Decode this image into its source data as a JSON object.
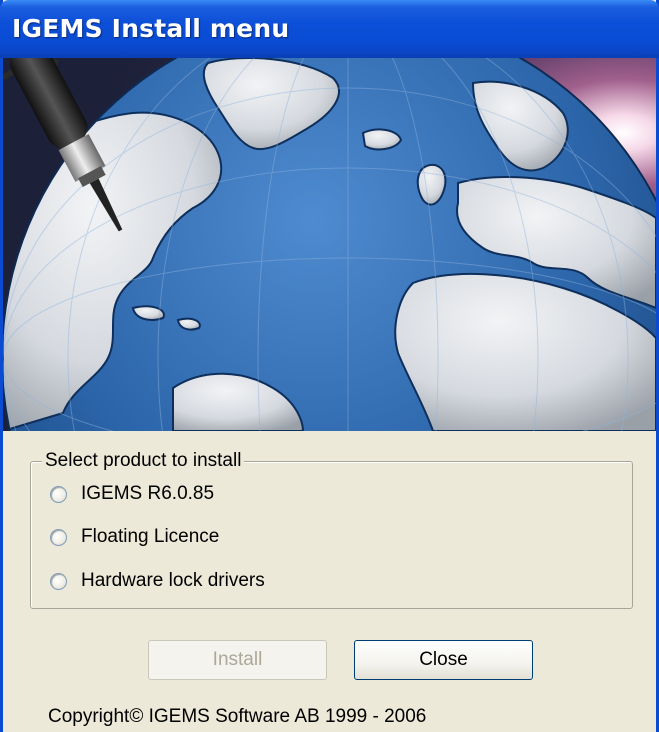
{
  "window": {
    "title": "IGEMS Install menu"
  },
  "product_group": {
    "label": "Select product to install",
    "options": [
      {
        "label": "IGEMS R6.0.85",
        "selected": false
      },
      {
        "label": "Floating Licence",
        "selected": false
      },
      {
        "label": "Hardware lock drivers",
        "selected": false
      }
    ]
  },
  "buttons": {
    "install": {
      "label": "Install",
      "enabled": false
    },
    "close": {
      "label": "Close",
      "enabled": true
    }
  },
  "footer": {
    "copyright": "Copyright© IGEMS Software AB 1999 - 2006"
  },
  "colors": {
    "titlebar": "#0a4cd4",
    "ocean": "#2b64a8",
    "land": "#d9dde2",
    "dialog_bg": "#ece9d8"
  }
}
